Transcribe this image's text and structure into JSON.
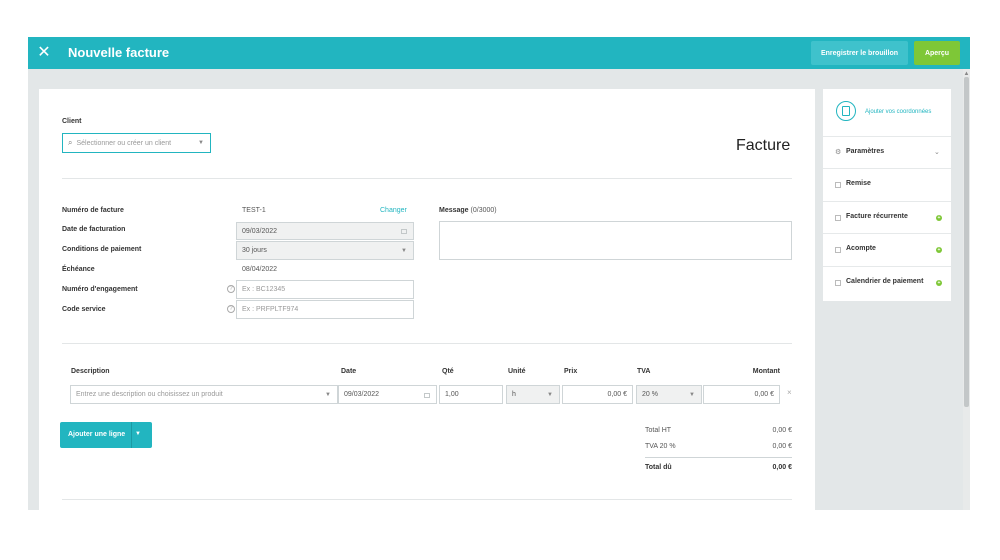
{
  "app": {
    "title": "Nouvelle facture",
    "save_draft_label": "Enregistrer le brouillon",
    "preview_label": "Aperçu",
    "colors": {
      "accent": "#22b5c0",
      "preview": "#7ec737"
    }
  },
  "client": {
    "label": "Client",
    "placeholder": "Sélectionner ou créer un client"
  },
  "doc_title": "Facture",
  "details": {
    "invoice_number_label": "Numéro de facture",
    "invoice_number_value": "TEST-1",
    "change_label": "Changer",
    "invoice_date_label": "Date de facturation",
    "invoice_date_value": "09/03/2022",
    "payment_terms_label": "Conditions de paiement",
    "payment_terms_value": "30 jours",
    "due_label": "Échéance",
    "due_value": "08/04/2022",
    "commitment_label": "Numéro d'engagement",
    "commitment_placeholder": "Ex : BC12345",
    "service_code_label": "Code service",
    "service_code_placeholder": "Ex : PRFPLTF974",
    "message_label": "Message",
    "message_count": "(0/3000)"
  },
  "lines": {
    "headers": {
      "description": "Description",
      "date": "Date",
      "qty": "Qté",
      "unit": "Unité",
      "price": "Prix",
      "vat": "TVA",
      "amount": "Montant"
    },
    "row": {
      "description_placeholder": "Entrez une description ou choisissez un produit",
      "date": "09/03/2022",
      "qty": "1,00",
      "unit": "h",
      "price": "0,00 €",
      "vat": "20 %",
      "amount": "0,00 €"
    },
    "add_line_label": "Ajouter une ligne"
  },
  "totals": {
    "ht_label": "Total HT",
    "ht_value": "0,00 €",
    "vat_label": "TVA 20 %",
    "vat_value": "0,00 €",
    "due_label": "Total dû",
    "due_value": "0,00 €"
  },
  "sidebar": {
    "add_details_label": "Ajouter vos coordonnées",
    "settings_label": "Paramètres",
    "items": [
      {
        "label": "Remise",
        "has_plus": false
      },
      {
        "label": "Facture récurrente",
        "has_plus": true
      },
      {
        "label": "Acompte",
        "has_plus": true
      },
      {
        "label": "Calendrier de paiement",
        "has_plus": true
      }
    ]
  }
}
